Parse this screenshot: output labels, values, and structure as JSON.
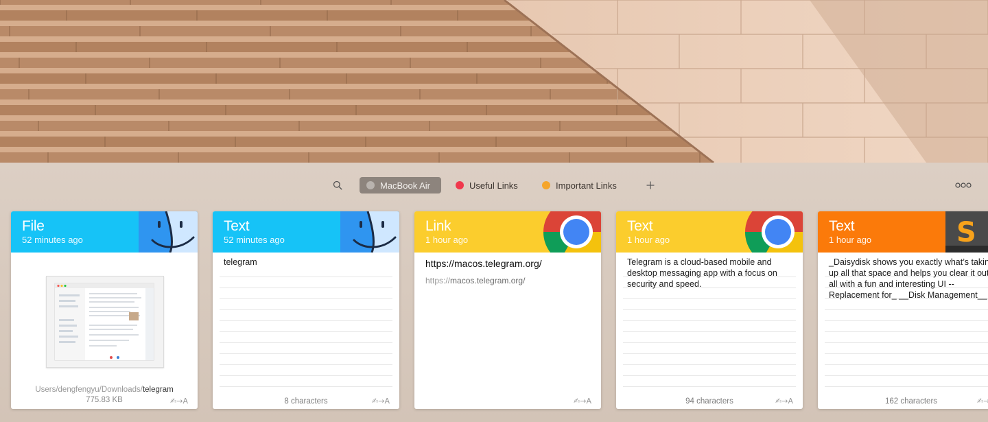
{
  "toolbar": {
    "search_icon": "search-icon",
    "pinboards": [
      {
        "label": "MacBook Air",
        "color": "#b9b3ae",
        "active": true
      },
      {
        "label": "Useful Links",
        "color": "#f0384d",
        "active": false
      },
      {
        "label": "Important Links",
        "color": "#f5a52a",
        "active": false
      }
    ],
    "add_icon": "plus-icon",
    "more_icon": "more-icon"
  },
  "cards": [
    {
      "type": "File",
      "time": "52 minutes ago",
      "color": "#16c3f7",
      "app_icon": "finder-icon",
      "path_prefix": "Users/dengfengyu/Downloads/",
      "path_name": "telegram",
      "size": "775.83 KB",
      "footer_icon": "✍→A"
    },
    {
      "type": "Text",
      "time": "52 minutes ago",
      "color": "#16c3f7",
      "app_icon": "finder-icon",
      "text": "telegram",
      "count": "8 characters",
      "footer_icon": "✍→A"
    },
    {
      "type": "Link",
      "time": "1 hour ago",
      "color": "#fbcd2d",
      "app_icon": "chrome-icon",
      "url": "https://macos.telegram.org/",
      "scheme": "https://",
      "host": "macos.telegram.org/",
      "footer_icon": "✍→A"
    },
    {
      "type": "Text",
      "time": "1 hour ago",
      "color": "#fbcd2d",
      "app_icon": "chrome-icon",
      "text": "Telegram is a cloud-based mobile and desktop messaging app with a focus on security and speed.",
      "count": "94 characters",
      "footer_icon": "✍→A"
    },
    {
      "type": "Text",
      "time": "1 hour ago",
      "color": "#fb7a0a",
      "app_icon": "sublime-icon",
      "text": "_Daisydisk shows you exactly what’s taking up all that space and helps you clear it out, all with a fun and interesting UI -- Replacement for_ __Disk Management__",
      "count": "162 characters",
      "footer_icon": "✍→A"
    }
  ]
}
